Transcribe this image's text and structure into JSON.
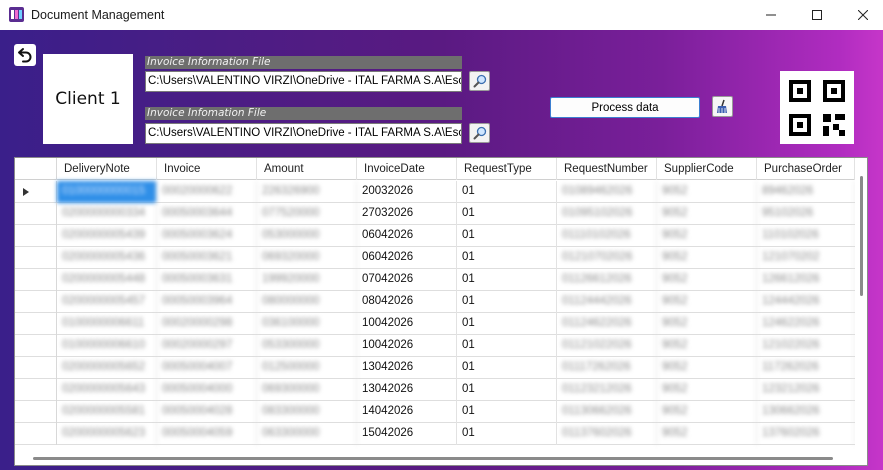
{
  "window": {
    "title": "Document Management",
    "icon": "app-document-icon"
  },
  "client": {
    "label": "Client 1"
  },
  "files": [
    {
      "label": "Invoice Information File",
      "value": "C:\\Users\\VALENTINO VIRZI\\OneDrive - ITAL FARMA S.A\\Escrit"
    },
    {
      "label": "Invoice Infomation File",
      "value": "C:\\Users\\VALENTINO VIRZI\\OneDrive - ITAL FARMA S.A\\Escrit"
    }
  ],
  "actions": {
    "process_label": "Process data"
  },
  "grid": {
    "columns": [
      "DeliveryNote",
      "Invoice",
      "Amount",
      "InvoiceDate",
      "RequestType",
      "RequestNumber",
      "SupplierCode",
      "PurchaseOrder"
    ],
    "rows": [
      {
        "current": true,
        "cells": [
          "0100000000015",
          "00020000622",
          "226326900",
          "20032026",
          "01",
          "01089462026",
          "9052",
          "89462026"
        ]
      },
      {
        "current": false,
        "cells": [
          "0200000000334",
          "00050003644",
          "077520000",
          "27032026",
          "01",
          "01095102026",
          "9052",
          "95102026"
        ]
      },
      {
        "current": false,
        "cells": [
          "0200000005439",
          "00050003624",
          "053000000",
          "06042026",
          "01",
          "01110102026",
          "9052",
          "110102026"
        ]
      },
      {
        "current": false,
        "cells": [
          "0200000005436",
          "00050003621",
          "069320000",
          "06042026",
          "01",
          "01210702026",
          "9052",
          "121070202"
        ]
      },
      {
        "current": false,
        "cells": [
          "0200000005448",
          "00050003631",
          "199920000",
          "07042026",
          "01",
          "01126612026",
          "9052",
          "126612026"
        ]
      },
      {
        "current": false,
        "cells": [
          "0200000005457",
          "00050003964",
          "080000000",
          "08042026",
          "01",
          "01124442026",
          "9052",
          "124442026"
        ]
      },
      {
        "current": false,
        "cells": [
          "0100000006611",
          "00020000298",
          "036100000",
          "10042026",
          "01",
          "01124622026",
          "9052",
          "124622026"
        ]
      },
      {
        "current": false,
        "cells": [
          "0100000006610",
          "00020000297",
          "053300000",
          "10042026",
          "01",
          "01121022026",
          "9052",
          "121022026"
        ]
      },
      {
        "current": false,
        "cells": [
          "0200000005652",
          "00050004007",
          "012500000",
          "13042026",
          "01",
          "01117262026",
          "9052",
          "117262026"
        ]
      },
      {
        "current": false,
        "cells": [
          "0200000005643",
          "00050004000",
          "069300000",
          "13042026",
          "01",
          "01123212026",
          "9052",
          "123212026"
        ]
      },
      {
        "current": false,
        "cells": [
          "0200000005581",
          "00050004028",
          "083300000",
          "14042026",
          "01",
          "01130662026",
          "9052",
          "130662026"
        ]
      },
      {
        "current": false,
        "cells": [
          "0200000005623",
          "00050004059",
          "063300000",
          "15042026",
          "01",
          "01137602026",
          "9052",
          "137602026"
        ]
      }
    ]
  },
  "colors": {
    "gradient_start": "#3a1f8a",
    "gradient_end": "#c636c9",
    "selection": "#2f8fe8",
    "file_label_bg": "#6e6e6e"
  }
}
